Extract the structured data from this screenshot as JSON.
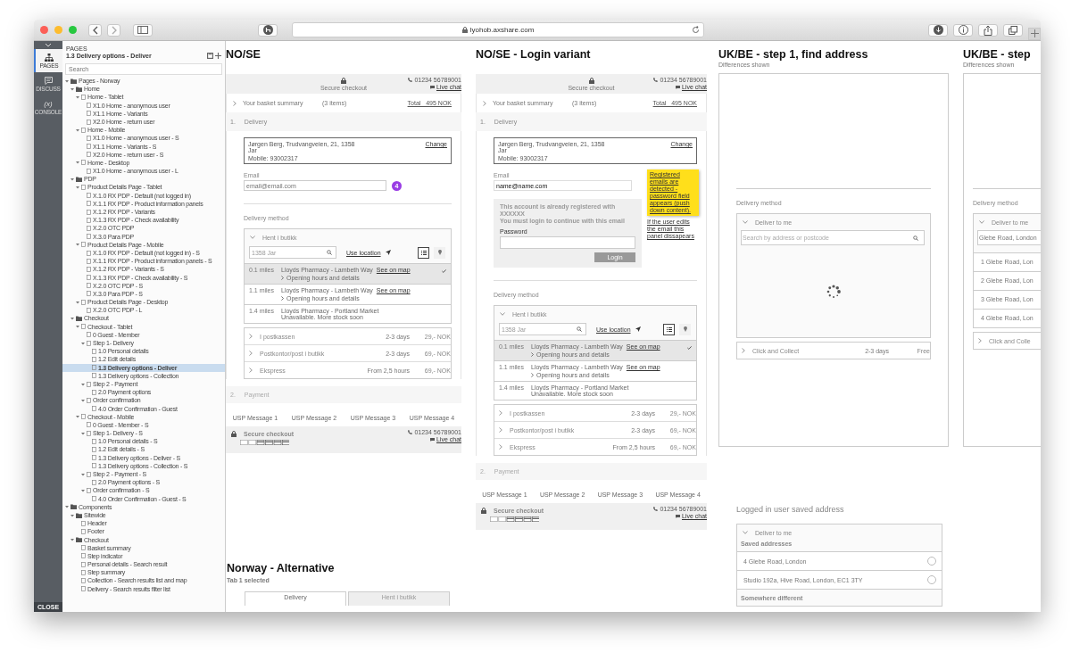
{
  "browser": {
    "url": "lyohob.axshare.com"
  },
  "rail": {
    "items": [
      {
        "label": "PAGES",
        "selected": true
      },
      {
        "label": "DISCUSS",
        "selected": false
      },
      {
        "glyph": "(x)",
        "label": "CONSOLE",
        "selected": false
      }
    ],
    "close": "CLOSE"
  },
  "sidebar": {
    "heading": "PAGES",
    "page_title": "1.3 Delivery options - Deliver",
    "search": {
      "placeholder": "Search"
    },
    "tree": [
      {
        "label": "Pages - Norway",
        "kind": "folder",
        "expanded": true,
        "selected": false,
        "children": [
          {
            "label": "Home",
            "kind": "folder",
            "expanded": true,
            "selected": false,
            "children": [
              {
                "label": "Home - Tablet",
                "kind": "page",
                "expanded": true,
                "selected": false,
                "children": [
                  {
                    "label": "X1.0 Home - anonymous user",
                    "kind": "page",
                    "selected": false
                  },
                  {
                    "label": "X1.1 Home - Variants",
                    "kind": "page",
                    "selected": false
                  },
                  {
                    "label": "X2.0 Home - return user",
                    "kind": "page",
                    "selected": false
                  }
                ]
              },
              {
                "label": "Home - Mobile",
                "kind": "page",
                "expanded": true,
                "selected": false,
                "children": [
                  {
                    "label": "X1.0 Home - anonymous user - S",
                    "kind": "page",
                    "selected": false
                  },
                  {
                    "label": "X1.1 Home - Variants - S",
                    "kind": "page",
                    "selected": false
                  },
                  {
                    "label": "X2.0 Home - return user - S",
                    "kind": "page",
                    "selected": false
                  }
                ]
              },
              {
                "label": "Home - Desktop",
                "kind": "page",
                "expanded": true,
                "selected": false,
                "children": [
                  {
                    "label": "X1.0 Home - anonymous user - L",
                    "kind": "page",
                    "selected": false
                  }
                ]
              }
            ]
          },
          {
            "label": "PDP",
            "kind": "folder",
            "expanded": true,
            "selected": false,
            "children": [
              {
                "label": "Product Details Page - Tablet",
                "kind": "page",
                "expanded": true,
                "selected": false,
                "children": [
                  {
                    "label": "X.1.0 RX PDP - Default (not logged in)",
                    "kind": "page",
                    "selected": false
                  },
                  {
                    "label": "X.1.1 RX PDP - Product information panels",
                    "kind": "page",
                    "selected": false
                  },
                  {
                    "label": "X.1.2 RX PDP - Variants",
                    "kind": "page",
                    "selected": false
                  },
                  {
                    "label": "X.1.3 RX PDP - Check availability",
                    "kind": "page",
                    "selected": false
                  },
                  {
                    "label": "X.2.0 OTC PDP",
                    "kind": "page",
                    "selected": false
                  },
                  {
                    "label": "X.3.0 Para PDP",
                    "kind": "page",
                    "selected": false
                  }
                ]
              },
              {
                "label": "Product Details Page - Mobile",
                "kind": "page",
                "expanded": true,
                "selected": false,
                "children": [
                  {
                    "label": "X.1.0 RX PDP - Default (not logged in) - S",
                    "kind": "page",
                    "selected": false
                  },
                  {
                    "label": "X.1.1 RX PDP - Product information panels - S",
                    "kind": "page",
                    "selected": false
                  },
                  {
                    "label": "X.1.2 RX PDP - Variants - S",
                    "kind": "page",
                    "selected": false
                  },
                  {
                    "label": "X.1.3 RX PDP - Check availability - S",
                    "kind": "page",
                    "selected": false
                  },
                  {
                    "label": "X.2.0 OTC PDP - S",
                    "kind": "page",
                    "selected": false
                  },
                  {
                    "label": "X.3.0 Para PDP - S",
                    "kind": "page",
                    "selected": false
                  }
                ]
              },
              {
                "label": "Product Details Page - Desktop",
                "kind": "page",
                "expanded": true,
                "selected": false,
                "children": [
                  {
                    "label": "X.2.0 OTC PDP - L",
                    "kind": "page",
                    "selected": false
                  }
                ]
              }
            ]
          },
          {
            "label": "Checkout",
            "kind": "folder",
            "expanded": true,
            "selected": false,
            "children": [
              {
                "label": "Checkout - Tablet",
                "kind": "page",
                "expanded": true,
                "selected": false,
                "children": [
                  {
                    "label": "0 Guest - Member",
                    "kind": "page",
                    "selected": false
                  },
                  {
                    "label": "Step 1- Delivery",
                    "kind": "page",
                    "expanded": true,
                    "selected": false,
                    "children": [
                      {
                        "label": "1.0 Personal details",
                        "kind": "page",
                        "selected": false
                      },
                      {
                        "label": "1.2 Edit details",
                        "kind": "page",
                        "selected": false
                      },
                      {
                        "label": "1.3 Delivery options - Deliver",
                        "kind": "page",
                        "selected": true
                      },
                      {
                        "label": "1.3 Delivery options - Collection",
                        "kind": "page",
                        "selected": false
                      }
                    ]
                  },
                  {
                    "label": "Step 2 - Payment",
                    "kind": "page",
                    "expanded": true,
                    "selected": false,
                    "children": [
                      {
                        "label": "2.0 Payment options",
                        "kind": "page",
                        "selected": false
                      }
                    ]
                  },
                  {
                    "label": "Order confirmation",
                    "kind": "page",
                    "expanded": true,
                    "selected": false,
                    "children": [
                      {
                        "label": "4.0 Order Confirmation - Guest",
                        "kind": "page",
                        "selected": false
                      }
                    ]
                  }
                ]
              },
              {
                "label": "Checkout - Mobile",
                "kind": "page",
                "expanded": true,
                "selected": false,
                "children": [
                  {
                    "label": "0 Guest - Member - S",
                    "kind": "page",
                    "selected": false
                  },
                  {
                    "label": "Step 1- Delivery - S",
                    "kind": "page",
                    "expanded": true,
                    "selected": false,
                    "children": [
                      {
                        "label": "1.0 Personal details - S",
                        "kind": "page",
                        "selected": false
                      },
                      {
                        "label": "1.2 Edit details - S",
                        "kind": "page",
                        "selected": false
                      },
                      {
                        "label": "1.3 Delivery options - Deliver - S",
                        "kind": "page",
                        "selected": false
                      },
                      {
                        "label": "1.3 Delivery options - Collection - S",
                        "kind": "page",
                        "selected": false
                      }
                    ]
                  },
                  {
                    "label": "Step 2 - Payment - S",
                    "kind": "page",
                    "expanded": true,
                    "selected": false,
                    "children": [
                      {
                        "label": "2.0 Payment options - S",
                        "kind": "page",
                        "selected": false
                      }
                    ]
                  },
                  {
                    "label": "Order confirmation - S",
                    "kind": "page",
                    "expanded": true,
                    "selected": false,
                    "children": [
                      {
                        "label": "4.0 Order Confirmation - Guest - S",
                        "kind": "page",
                        "selected": false
                      }
                    ]
                  }
                ]
              }
            ]
          }
        ]
      },
      {
        "label": "Components",
        "kind": "folder",
        "expanded": true,
        "selected": false,
        "children": [
          {
            "label": "Sitewide",
            "kind": "folder",
            "expanded": true,
            "selected": false,
            "children": [
              {
                "label": "Header",
                "kind": "page",
                "selected": false
              },
              {
                "label": "Footer",
                "kind": "page",
                "selected": false
              }
            ]
          },
          {
            "label": "Checkout",
            "kind": "folder",
            "expanded": true,
            "selected": false,
            "children": [
              {
                "label": "Basket summary",
                "kind": "page",
                "selected": false
              },
              {
                "label": "Step indicator",
                "kind": "page",
                "selected": false
              },
              {
                "label": "Personal details - Search result",
                "kind": "page",
                "selected": false
              },
              {
                "label": "Step summary",
                "kind": "page",
                "selected": false
              },
              {
                "label": "Collection - Search results list and map",
                "kind": "page",
                "selected": false
              },
              {
                "label": "Delivery - Search results filter list",
                "kind": "page",
                "selected": false
              }
            ]
          }
        ]
      }
    ]
  },
  "artboards": [
    {
      "kind": "checkout",
      "title": "NO/SE",
      "header": {
        "secure": "Secure checkout",
        "phone": "01234 56789001",
        "chat": "Live chat"
      },
      "basket": {
        "label": "Your basket summary",
        "count": "(3 items)",
        "total": "Total   495 NOK"
      },
      "step1": {
        "number": "1.",
        "label": "Delivery"
      },
      "address": {
        "lines": [
          "Jørgen Berg, Trudvangveien, 21, 1358",
          "Jar"
        ],
        "mobile": "Mobile: 93002317",
        "change": "Change"
      },
      "email": {
        "label": "Email",
        "placeholder": "email@email.com",
        "badge": "4"
      },
      "method_label": "Delivery method",
      "store_panel": {
        "title": "Hent i butikk",
        "expanded": true,
        "search": "1358 Jar",
        "use_location": "Use location",
        "views": [
          {
            "selected": true
          },
          {
            "selected": false
          }
        ]
      },
      "stores": [
        {
          "distance": "0.1 miles",
          "name": "Lloyds Pharmacy - Lambeth Way",
          "link": "See on map",
          "details": "Opening hours and details",
          "selected": true
        },
        {
          "distance": "1.1 miles",
          "name": "Lloyds Pharmacy - Lambeth Way",
          "link": "See on map",
          "details": "Opening hours and details",
          "selected": false
        },
        {
          "distance": "1.4 miles",
          "name": "Lloyds Pharmacy - Portland Market",
          "status": "Unavailable. More stock soon",
          "selected": false
        }
      ],
      "options": [
        {
          "label": "I postkassen",
          "time": "2-3 days",
          "price": "29,- NOK",
          "expanded": false
        },
        {
          "label": "Postkontor/post i butikk",
          "time": "2-3 days",
          "price": "69,- NOK",
          "expanded": false
        },
        {
          "label": "Ekspress",
          "time": "From 2,5 hours",
          "price": "69,- NOK",
          "expanded": false
        }
      ],
      "step2": {
        "number": "2.",
        "label": "Payment"
      },
      "usps": [
        "USP Message 1",
        "USP Message 2",
        "USP Message 3",
        "USP Message 4"
      ],
      "footer": {
        "secure": "Secure checkout",
        "phone": "01234 56789001",
        "chat": "Live chat"
      }
    },
    {
      "kind": "tabs_variant",
      "title": "Norway - Alternative",
      "subtitle": "Tab 1 selected",
      "tabs": [
        {
          "label": "Delivery",
          "selected": true
        },
        {
          "label": "Hent i butikk",
          "selected": false
        }
      ]
    },
    {
      "kind": "checkout",
      "title": "NO/SE - Login variant",
      "header": {
        "secure": "Secure checkout",
        "phone": "01234 56789001",
        "chat": "Live chat"
      },
      "basket": {
        "label": "Your basket summary",
        "count": "(3 items)",
        "total": "Total   495 NOK"
      },
      "step1": {
        "number": "1.",
        "label": "Delivery"
      },
      "address": {
        "lines": [
          "Jørgen Berg, Trudvangveien, 21, 1358",
          "Jar"
        ],
        "mobile": "Mobile: 93002317",
        "change": "Change"
      },
      "email": {
        "label": "Email",
        "value": "name@name.com"
      },
      "note": {
        "text": "Registered emails are detected - password field appears (push down content).",
        "comment": "If the user edits the email this panel dissapears"
      },
      "login": {
        "message": [
          "This account is already registered with XXXXXX",
          "You must login to continue with this email"
        ],
        "password_label": "Password",
        "button": "Login"
      },
      "method_label": "Delivery method",
      "store_panel": {
        "title": "Hent i butikk",
        "expanded": true,
        "search": "1358 Jar",
        "use_location": "Use location",
        "views": [
          {
            "selected": true
          },
          {
            "selected": false
          }
        ]
      },
      "stores": [
        {
          "distance": "0.1 miles",
          "name": "Lloyds Pharmacy - Lambeth Way",
          "link": "See on map",
          "details": "Opening hours and details",
          "selected": true
        },
        {
          "distance": "1.1 miles",
          "name": "Lloyds Pharmacy - Lambeth Way",
          "link": "See on map",
          "details": "Opening hours and details",
          "selected": false
        },
        {
          "distance": "1.4 miles",
          "name": "Lloyds Pharmacy - Portland Market",
          "status": "Unavailable. More stock soon",
          "selected": false
        }
      ],
      "options": [
        {
          "label": "I postkassen",
          "time": "2-3 days",
          "price": "29,- NOK",
          "expanded": false
        },
        {
          "label": "Postkontor/post i butikk",
          "time": "2-3 days",
          "price": "69,- NOK",
          "expanded": false
        },
        {
          "label": "Ekspress",
          "time": "From 2,5 hours",
          "price": "69,- NOK",
          "expanded": false
        }
      ],
      "step2": {
        "number": "2.",
        "label": "Payment"
      },
      "usps": [
        "USP Message 1",
        "USP Message 2",
        "USP Message 3",
        "USP Message 4"
      ],
      "footer": {
        "secure": "Secure checkout",
        "phone": "01234 56789001",
        "chat": "Live chat"
      }
    },
    {
      "kind": "address_search",
      "title": "UK/BE - step 1, find address",
      "subtitle": "Differences shown",
      "method_label": "Delivery method",
      "panel": {
        "title": "Deliver to me",
        "expanded": true,
        "search": {
          "placeholder": "Search by address or postcode"
        },
        "loading": true
      },
      "options": [
        {
          "label": "Click and Collect",
          "time": "2-3 days",
          "price": "Free",
          "expanded": false
        }
      ]
    },
    {
      "kind": "saved_addresses",
      "title": "Logged in user saved address",
      "panel": {
        "title": "Deliver to me",
        "expanded": true,
        "subheading": "Saved addresses",
        "addresses": [
          {
            "label": "4 Glebe Road, London",
            "selected": false
          },
          {
            "label": "Studio 192a, Hive Road, London, EC1 3TY",
            "selected": false
          }
        ],
        "other": "Somewhere different"
      }
    },
    {
      "kind": "address_search",
      "title": "UK/BE - step",
      "subtitle": "Differences shown",
      "method_label": "Delivery method",
      "panel": {
        "title": "Deliver to me",
        "expanded": true,
        "search": {
          "value": "Glebe Road, London"
        },
        "results": [
          "1 Glebe Road, Lon",
          "2 Glebe Road, Lon",
          "3 Glebe Road, Lon",
          "4 Glebe Road, Lon"
        ]
      },
      "options": [
        {
          "label": "Click and Colle",
          "expanded": false
        }
      ]
    }
  ]
}
